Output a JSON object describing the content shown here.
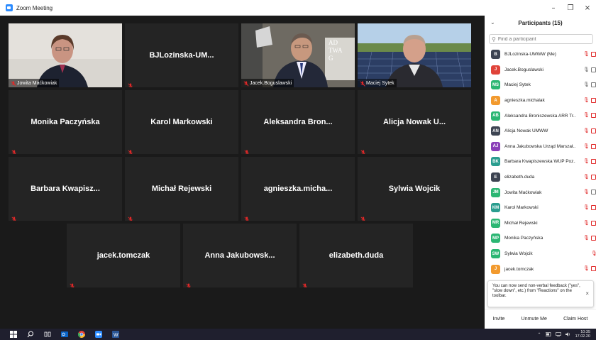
{
  "window": {
    "title": "Zoom Meeting",
    "controls": {
      "minimize": "–",
      "maximize": "❐",
      "close": "×"
    }
  },
  "gallery": {
    "tiles": [
      {
        "type": "video",
        "label": "Jowita Maćkowiak",
        "scene": "woman"
      },
      {
        "type": "name",
        "name": "BJLozinska-UM..."
      },
      {
        "type": "video",
        "label": "Jacek.Boguslawski",
        "scene": "man-office",
        "active": true,
        "bg_text": "AD\nTWA\nG"
      },
      {
        "type": "video",
        "label": "Maciej Sytek",
        "scene": "man-solar"
      },
      {
        "type": "name",
        "name": "Monika Paczyńska"
      },
      {
        "type": "name",
        "name": "Karol Markowski"
      },
      {
        "type": "name",
        "name": "Aleksandra  Bron..."
      },
      {
        "type": "name",
        "name": "Alicja Nowak U..."
      },
      {
        "type": "name",
        "name": "Barbara  Kwapisz..."
      },
      {
        "type": "name",
        "name": "Michał Rejewski"
      },
      {
        "type": "name",
        "name": "agnieszka.micha..."
      },
      {
        "type": "name",
        "name": "Sylwia Wojcik"
      },
      {
        "type": "name",
        "name": "jacek.tomczak"
      },
      {
        "type": "name",
        "name": "Anna  Jakubowsk..."
      },
      {
        "type": "name",
        "name": "elizabeth.duda"
      }
    ]
  },
  "participants": {
    "title": "Participants (15)",
    "search_placeholder": "Find a participant",
    "list": [
      {
        "initials": "B",
        "color": "#3d4452",
        "name": "BJLozinska-UMWW (Me)",
        "mic": "muted",
        "cam": "off"
      },
      {
        "initials": "J",
        "color": "#e0433a",
        "name": "Jacek.Boguslawski",
        "mic": "on",
        "cam": "on"
      },
      {
        "initials": "MS",
        "color": "#2bb673",
        "name": "Maciej Sytek",
        "mic": "on",
        "cam": "on"
      },
      {
        "initials": "A",
        "color": "#f29a2e",
        "name": "agnieszka.michalak",
        "mic": "muted",
        "cam": "off"
      },
      {
        "initials": "AB",
        "color": "#2bb673",
        "name": "Aleksandra Broniszewska ARR Tr...",
        "mic": "muted",
        "cam": "off"
      },
      {
        "initials": "AN",
        "color": "#3d4452",
        "name": "Alicja Nowak UMWW",
        "mic": "muted",
        "cam": "off"
      },
      {
        "initials": "AJ",
        "color": "#8a3fb8",
        "name": "Anna Jakubowska Urząd Marszał...",
        "mic": "muted",
        "cam": "off"
      },
      {
        "initials": "BK",
        "color": "#2a9d8f",
        "name": "Barbara Kwapiszewska WUP Poz...",
        "mic": "muted",
        "cam": "off"
      },
      {
        "initials": "E",
        "color": "#3d4452",
        "name": "elizabeth.duda",
        "mic": "muted",
        "cam": "off"
      },
      {
        "initials": "JM",
        "color": "#2bb673",
        "name": "Jowita Maćkowiak",
        "mic": "muted",
        "cam": "on"
      },
      {
        "initials": "KM",
        "color": "#2a9d8f",
        "name": "Karol Markowski",
        "mic": "muted",
        "cam": "off"
      },
      {
        "initials": "MR",
        "color": "#2bb673",
        "name": "Michał Rejewski",
        "mic": "muted",
        "cam": "off"
      },
      {
        "initials": "MP",
        "color": "#2bb673",
        "name": "Monika Paczyńska",
        "mic": "muted",
        "cam": "off"
      },
      {
        "initials": "SW",
        "color": "#2bb673",
        "name": "Sylwia Wojcik",
        "mic": "muted",
        "cam": "none"
      },
      {
        "initials": "J",
        "color": "#f29a2e",
        "name": "jacek.tomczak",
        "mic": "muted",
        "cam": "off"
      }
    ],
    "toast": "You can now send non-verbal feedback (\"yes\", \"slow down\", etc.) from \"Reactions\" on the toolbar.",
    "toast_close": "×",
    "buttons": {
      "invite": "Invite",
      "unmute_me": "Unmute Me",
      "claim_host": "Claim Host"
    }
  },
  "taskbar": {
    "time": "10:35",
    "date": "17.02.20",
    "tray_chevron": "⌃"
  },
  "colors": {
    "active_speaker": "#a6d23c",
    "muted": "#e02828",
    "tile_bg": "#242424",
    "gallery_bg": "#1a1a1a"
  }
}
